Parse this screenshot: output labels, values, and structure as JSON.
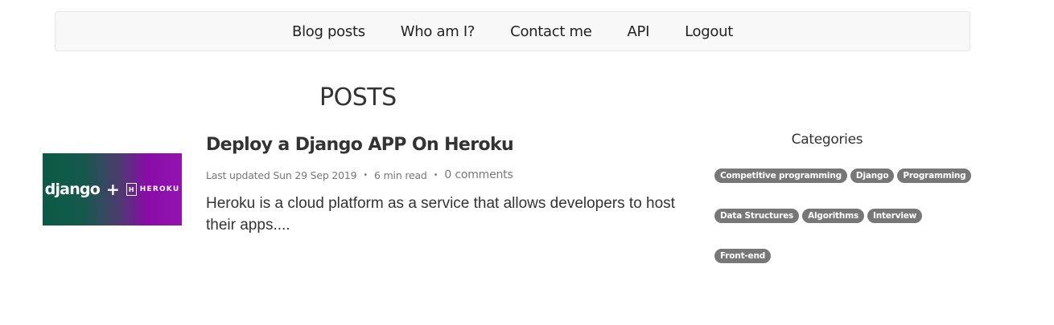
{
  "nav": {
    "items": [
      {
        "label": "Blog posts"
      },
      {
        "label": "Who am I?"
      },
      {
        "label": "Contact me"
      },
      {
        "label": "API"
      },
      {
        "label": "Logout"
      }
    ]
  },
  "page": {
    "title": "POSTS"
  },
  "post": {
    "thumbnail": {
      "left_text": "django",
      "plus": "+",
      "logo_letter": "H",
      "right_text": "HEROKU"
    },
    "title": "Deploy a Django APP On Heroku",
    "last_updated": "Last updated Sun 29 Sep 2019",
    "separator": "•",
    "read_time": "6 min read",
    "comments": "0 comments",
    "excerpt": "Heroku is a cloud platform as a service that allows developers to host their apps...."
  },
  "sidebar": {
    "title": "Categories",
    "tags": [
      "Competitive programming",
      "Django",
      "Programming",
      "Data Structures",
      "Algorithms",
      "Interview",
      "Front-end"
    ]
  },
  "colors": {
    "navbar_bg": "#f8f8f8",
    "tag_bg": "#777777",
    "thumb_start": "#0b5a45",
    "thumb_end": "#9213b0"
  }
}
